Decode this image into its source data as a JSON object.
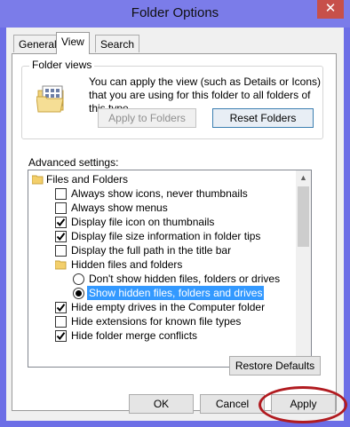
{
  "window": {
    "title": "Folder Options",
    "close_glyph": "✕"
  },
  "tabs": [
    {
      "label": "General",
      "active": false
    },
    {
      "label": "View",
      "active": true
    },
    {
      "label": "Search",
      "active": false
    }
  ],
  "folder_views": {
    "label": "Folder views",
    "description": "You can apply the view (such as Details or Icons) that you are using for this folder to all folders of this type.",
    "apply_label": "Apply to Folders",
    "reset_label": "Reset Folders",
    "icon": "folder-view-icon"
  },
  "advanced": {
    "label": "Advanced settings:",
    "items": [
      {
        "type": "folder",
        "label": "Files and Folders"
      },
      {
        "type": "checkbox",
        "label": "Always show icons, never thumbnails",
        "checked": false
      },
      {
        "type": "checkbox",
        "label": "Always show menus",
        "checked": false
      },
      {
        "type": "checkbox",
        "label": "Display file icon on thumbnails",
        "checked": true
      },
      {
        "type": "checkbox",
        "label": "Display file size information in folder tips",
        "checked": true
      },
      {
        "type": "checkbox",
        "label": "Display the full path in the title bar",
        "checked": false
      },
      {
        "type": "folder",
        "label": "Hidden files and folders"
      },
      {
        "type": "radio",
        "label": "Don't show hidden files, folders or drives",
        "checked": false
      },
      {
        "type": "radio",
        "label": "Show hidden files, folders and drives",
        "checked": true,
        "selected": true
      },
      {
        "type": "checkbox",
        "label": "Hide empty drives in the Computer folder",
        "checked": true
      },
      {
        "type": "checkbox",
        "label": "Hide extensions for known file types",
        "checked": false
      },
      {
        "type": "checkbox",
        "label": "Hide folder merge conflicts",
        "checked": true
      }
    ]
  },
  "buttons": {
    "restore_defaults": "Restore Defaults",
    "ok": "OK",
    "cancel": "Cancel",
    "apply": "Apply"
  },
  "colors": {
    "title_bar": "#7b7ce9",
    "close_button": "#c7504a",
    "selection": "#3399ff",
    "highlight_ring": "#b11b20"
  }
}
